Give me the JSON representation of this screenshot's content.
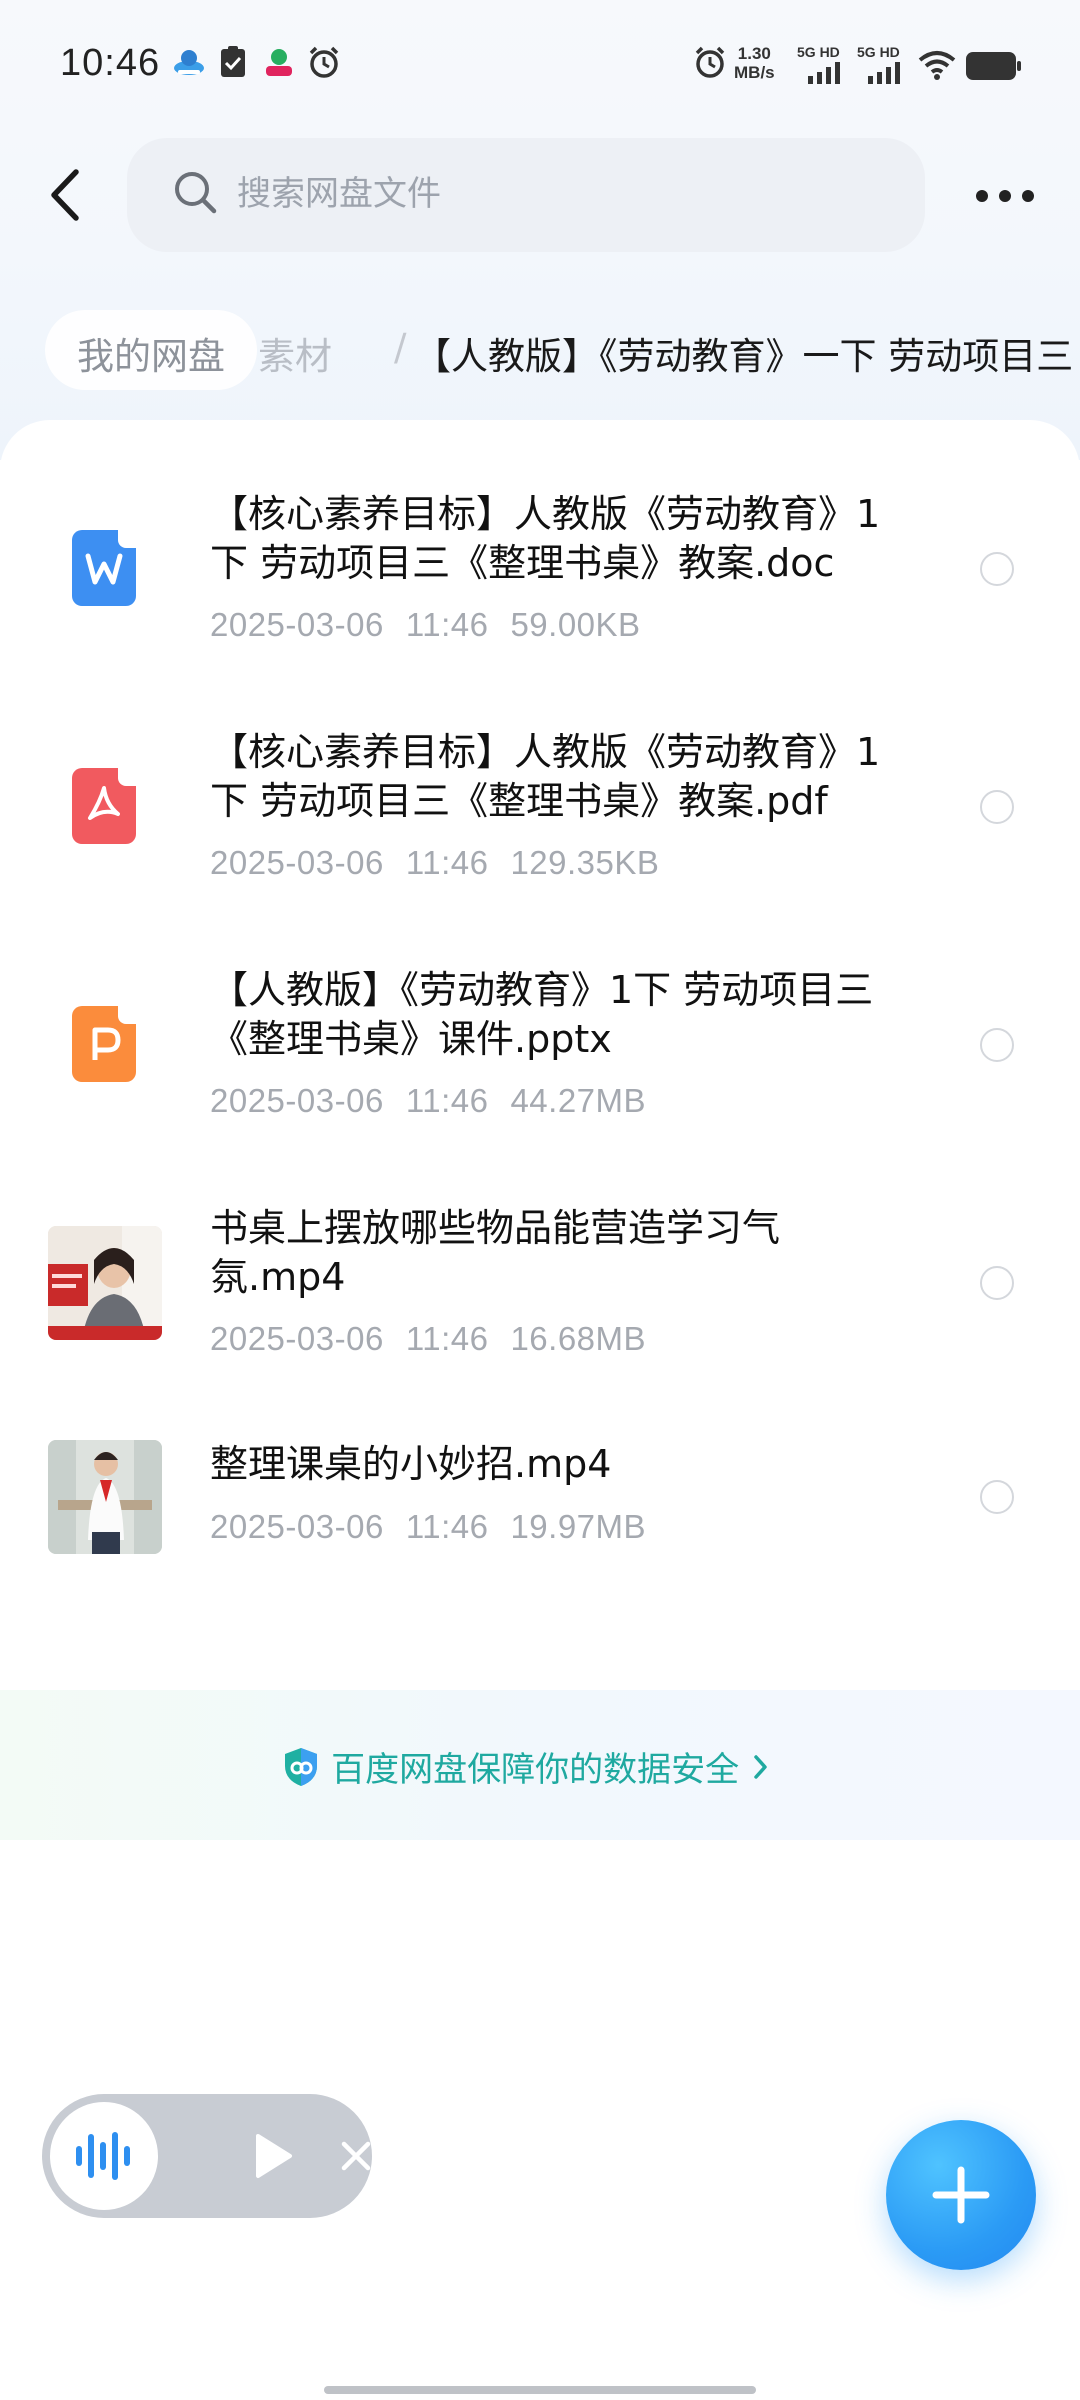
{
  "status_bar": {
    "time": "10:46",
    "speed_value": "1.30",
    "speed_unit": "MB/s",
    "net1": "5G HD",
    "net2": "5G HD",
    "icons": [
      "cloud-app-icon",
      "check-clipboard-icon",
      "app-notification-icon",
      "alarm-icon",
      "alarm-icon",
      "signal-icon",
      "signal-icon",
      "wifi-icon",
      "battery-icon"
    ]
  },
  "header": {
    "search_placeholder": "搜索网盘文件"
  },
  "breadcrumb": {
    "root": "我的网盘",
    "middle": "素材",
    "separator": "/",
    "current": "【人教版】《劳动教育》一下 劳动项目三"
  },
  "files": [
    {
      "name": "【核心素养目标】人教版《劳动教育》1下 劳动项目三《整理书桌》教案.doc",
      "date": "2025-03-06",
      "time": "11:46",
      "size": "59.00KB",
      "icon": "word-doc-icon",
      "color": "#3d8ff2"
    },
    {
      "name": "【核心素养目标】人教版《劳动教育》1下 劳动项目三《整理书桌》教案.pdf",
      "date": "2025-03-06",
      "time": "11:46",
      "size": "129.35KB",
      "icon": "pdf-icon",
      "color": "#f15a5f"
    },
    {
      "name": "【人教版】《劳动教育》1下 劳动项目三《整理书桌》课件.pptx",
      "date": "2025-03-06",
      "time": "11:46",
      "size": "44.27MB",
      "icon": "ppt-icon",
      "color": "#fb8c3c"
    },
    {
      "name": "书桌上摆放哪些物品能营造学习气氛.mp4",
      "date": "2025-03-06",
      "time": "11:46",
      "size": "16.68MB",
      "icon": "video-thumbnail"
    },
    {
      "name": "整理课桌的小妙招.mp4",
      "date": "2025-03-06",
      "time": "11:46",
      "size": "19.97MB",
      "icon": "video-thumbnail"
    }
  ],
  "security_banner": {
    "text": "百度网盘保障你的数据安全",
    "accent": "#1fa9a0"
  },
  "theme": {
    "fab_color": "#2b9bf5",
    "voice_accent": "#2e8ff0"
  }
}
